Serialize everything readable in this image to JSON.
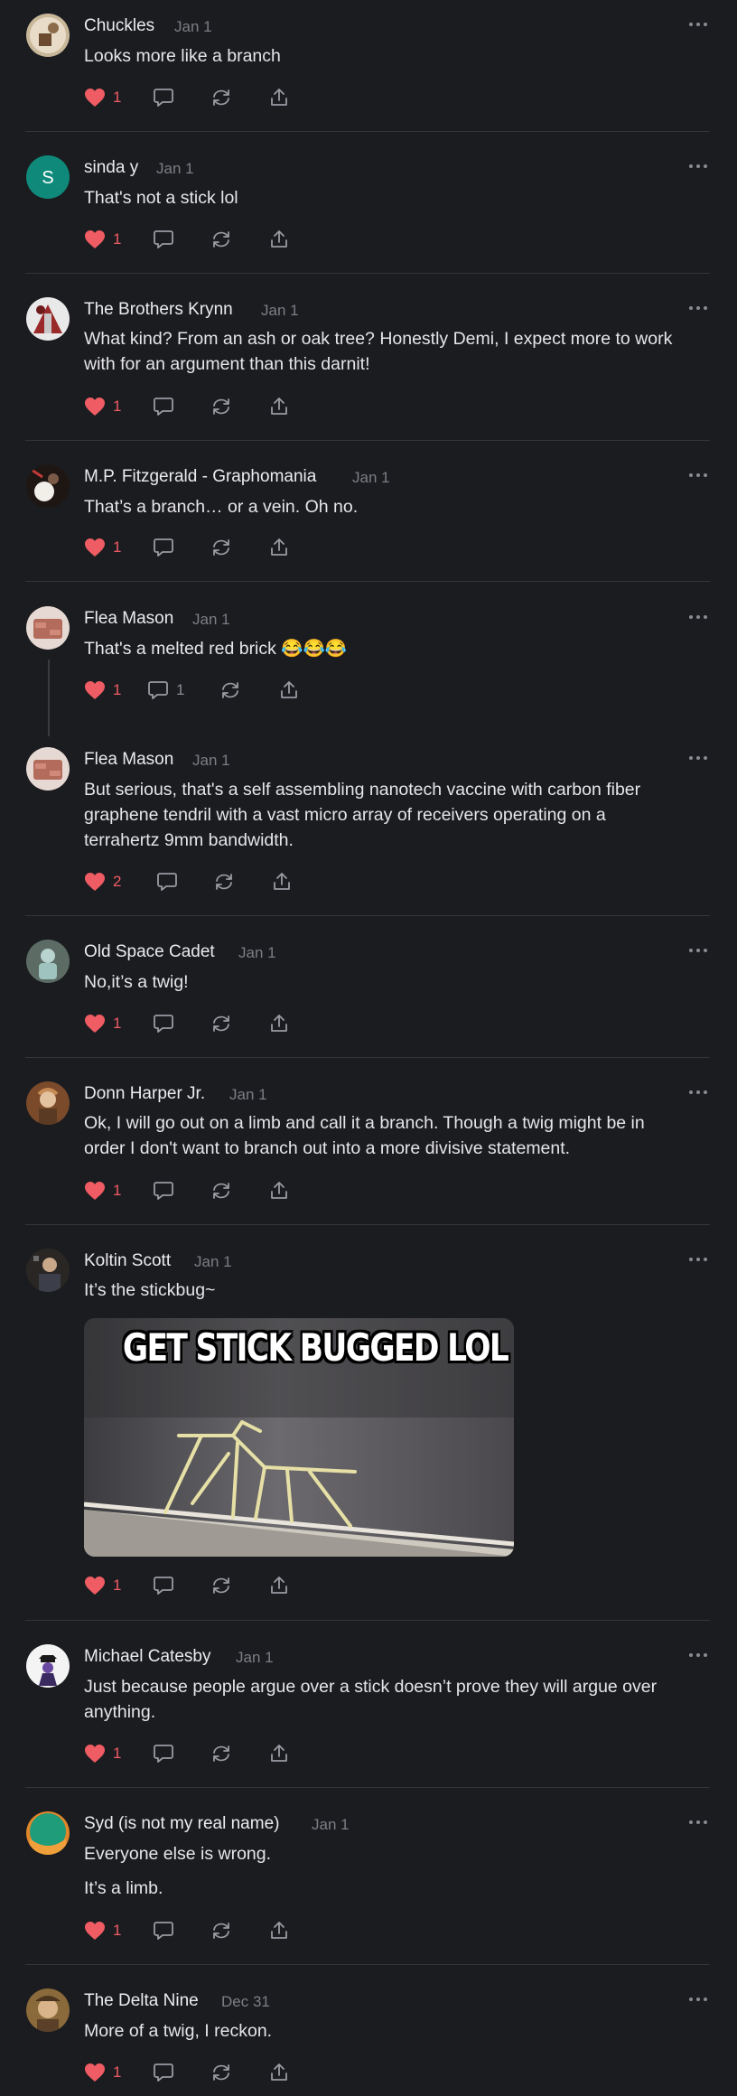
{
  "colors": {
    "background": "#1b1c20",
    "divider": "#34353a",
    "like": "#ef5c63",
    "muted": "#7d7e85"
  },
  "icons": {
    "like": "heart-icon",
    "reply": "comment-bubble-icon",
    "repost": "repost-icon",
    "share": "share-icon",
    "more": "more-dots-icon"
  },
  "comments": [
    {
      "author": "Chuckles",
      "date": "Jan 1",
      "lines": [
        "Looks more like a branch"
      ],
      "likes": "1",
      "replies": ""
    },
    {
      "author": "sinda y",
      "date": "Jan 1",
      "avatar_letter": "S",
      "lines": [
        "That's not a stick lol"
      ],
      "likes": "1",
      "replies": ""
    },
    {
      "author": "The Brothers Krynn",
      "date": "Jan 1",
      "lines": [
        "What kind? From an ash or oak tree? Honestly Demi, I expect more to work",
        "with for an argument than this darnit!"
      ],
      "likes": "1",
      "replies": ""
    },
    {
      "author": "M.P. Fitzgerald - Graphomania",
      "date": "Jan 1",
      "lines": [
        "That’s a branch… or a vein. Oh no."
      ],
      "likes": "1",
      "replies": ""
    },
    {
      "author": "Flea Mason",
      "date": "Jan 1",
      "lines": [
        "That's a melted red brick 😂😂😂"
      ],
      "likes": "1",
      "replies": "1"
    },
    {
      "author": "Flea Mason",
      "date": "Jan 1",
      "lines": [
        "But serious, that's a self assembling nanotech vaccine with carbon fiber",
        "graphene tendril with a vast micro array of receivers operating on a",
        "terrahertz 9mm bandwidth."
      ],
      "likes": "2",
      "replies": ""
    },
    {
      "author": "Old Space Cadet",
      "date": "Jan 1",
      "lines": [
        "No,it’s a twig!"
      ],
      "likes": "1",
      "replies": ""
    },
    {
      "author": "Donn Harper Jr.",
      "date": "Jan 1",
      "lines": [
        "Ok, I will go out on a limb and call it a branch. Though a twig might be in",
        "order I don't want to branch out into a more divisive statement."
      ],
      "likes": "1",
      "replies": ""
    },
    {
      "author": "Koltin Scott",
      "date": "Jan 1",
      "lines": [
        "It’s the stickbug~"
      ],
      "image_caption": "GET STICK BUGGED LOL",
      "likes": "1",
      "replies": ""
    },
    {
      "author": "Michael Catesby",
      "date": "Jan 1",
      "lines": [
        "Just because people argue over a stick doesn’t prove they will argue over",
        "anything."
      ],
      "likes": "1",
      "replies": ""
    },
    {
      "author": "Syd (is not my real name)",
      "date": "Jan 1",
      "lines": [
        "Everyone else is wrong.",
        "It’s a limb."
      ],
      "likes": "1",
      "replies": ""
    },
    {
      "author": "The Delta Nine",
      "date": "Dec 31",
      "lines": [
        "More of a twig, I reckon."
      ],
      "likes": "1",
      "replies": ""
    }
  ]
}
